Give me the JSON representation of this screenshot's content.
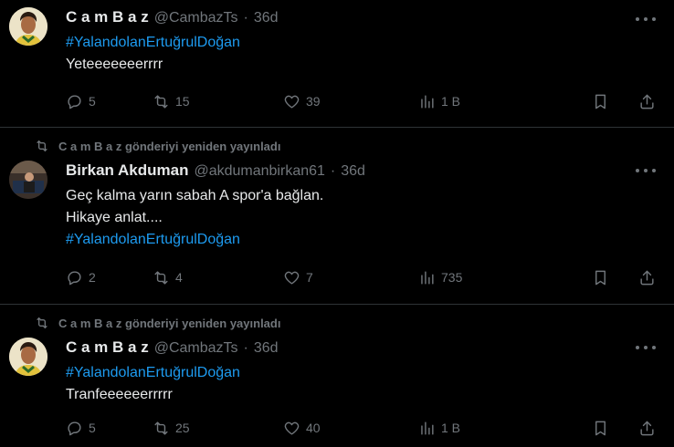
{
  "tweets": [
    {
      "repost_text": "",
      "author_name": "C a m B a z",
      "handle": "@CambazTs",
      "separator": "·",
      "time": "36d",
      "lines": [],
      "hashtag": "#YalandolanErtuğrulDoğan",
      "after_lines": [
        "Yeteeeeeeerrrr"
      ],
      "replies": "5",
      "reposts": "15",
      "likes": "39",
      "views": "1 B",
      "avatar": "avatar-man-yellow"
    },
    {
      "repost_text": "C a m B a z gönderiyi yeniden yayınladı",
      "author_name": "Birkan Akduman",
      "handle": "@akdumanbirkan61",
      "separator": "·",
      "time": "36d",
      "lines": [
        "Geç kalma yarın sabah A spor'a bağlan.",
        "Hikaye anlat...."
      ],
      "hashtag": "#YalandolanErtuğrulDoğan",
      "after_lines": [],
      "replies": "2",
      "reposts": "4",
      "likes": "7",
      "views": "735",
      "avatar": "avatar-man-seated"
    },
    {
      "repost_text": "C a m B a z gönderiyi yeniden yayınladı",
      "author_name": "C a m B a z",
      "handle": "@CambazTs",
      "separator": "·",
      "time": "36d",
      "lines": [],
      "hashtag": "#YalandolanErtuğrulDoğan",
      "after_lines": [
        "Tranfeeeeeerrrrr"
      ],
      "replies": "5",
      "reposts": "25",
      "likes": "40",
      "views": "1 B",
      "avatar": "avatar-man-yellow"
    }
  ],
  "colors": {
    "background": "#000000",
    "text": "#e7e9ea",
    "muted": "#71767b",
    "link": "#1d9bf0",
    "divider": "#2f3336"
  },
  "icons": [
    "reply-icon",
    "repost-icon",
    "like-icon",
    "views-icon",
    "bookmark-icon",
    "share-icon",
    "more-icon"
  ]
}
